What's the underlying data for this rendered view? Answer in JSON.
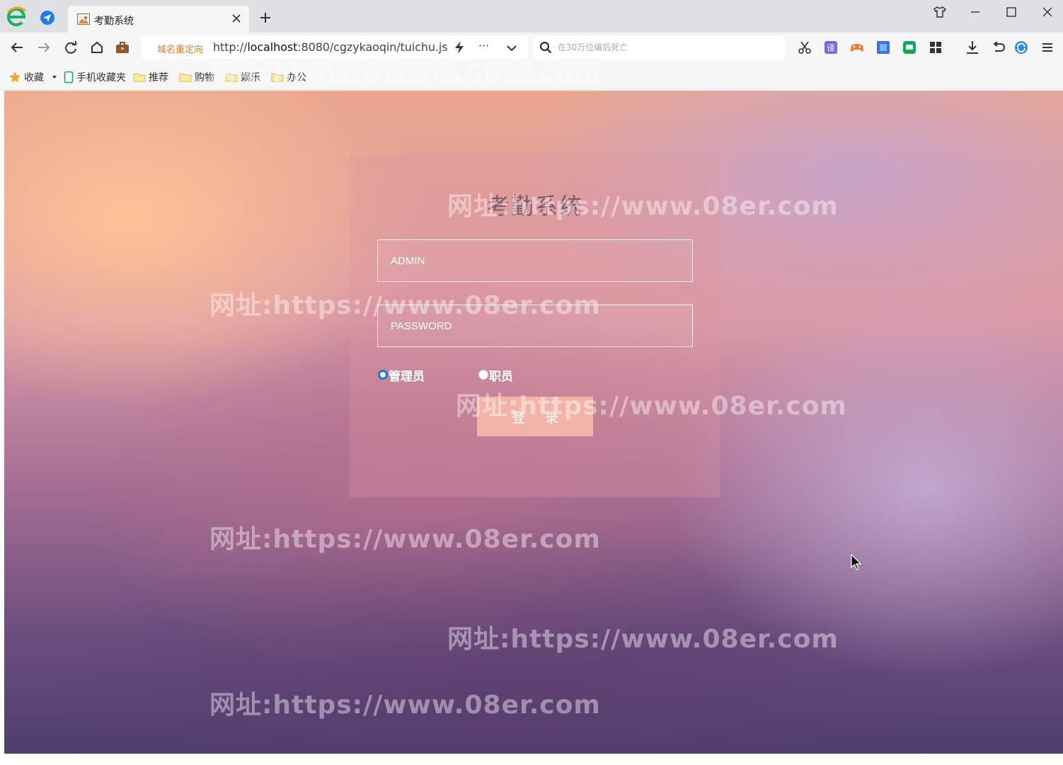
{
  "browser": {
    "tab": {
      "title": "考勤系统"
    },
    "address": {
      "redirect_label": "域名重定向",
      "url_prefix": "http://",
      "url_host": "localhost",
      "url_rest": ":8080/cgzykaoqin/tuichu.js",
      "more_label": "···"
    },
    "search": {
      "placeholder": "在30万位编后死亡"
    },
    "bookmarks": [
      {
        "label": "收藏"
      },
      {
        "label": "手机收藏夹"
      },
      {
        "label": "推荐"
      },
      {
        "label": "购物"
      },
      {
        "label": "娱乐"
      },
      {
        "label": "办公"
      }
    ]
  },
  "login": {
    "title": "考勤系统",
    "username_placeholder": "ADMIN",
    "password_placeholder": "PASSWORD",
    "roles": [
      {
        "label": "管理员",
        "selected": true
      },
      {
        "label": "职员",
        "selected": false
      }
    ],
    "submit_label": "登录"
  },
  "watermark": {
    "text": "网址:https://www.08er.com"
  },
  "colors": {
    "tab_bar": "#dfe1e5",
    "toolbar": "#f7f7f8",
    "redirect_text": "#ee7a2a",
    "login_button": "#f1b5a7",
    "radio_selected": "#1a73e8"
  }
}
